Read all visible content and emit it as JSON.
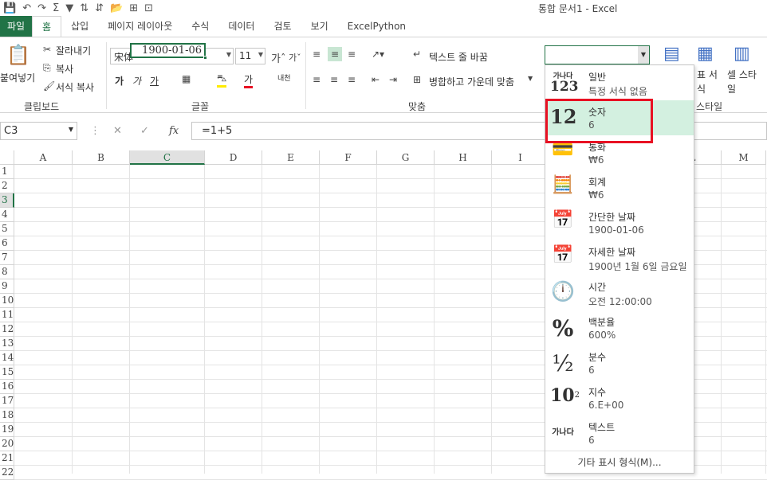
{
  "window": {
    "title": "통합 문서1 - Excel"
  },
  "qat": [
    "save-icon",
    "undo-icon",
    "redo-icon",
    "sum-icon",
    "filter-icon",
    "sort-asc-icon",
    "sort-desc-icon",
    "open-icon",
    "icon-a",
    "icon-b"
  ],
  "tabs": [
    "파일",
    "홈",
    "삽입",
    "페이지 레이아웃",
    "수식",
    "데이터",
    "검토",
    "보기",
    "ExcelPython"
  ],
  "ribbon": {
    "clipboard": {
      "paste": "붙여넣기",
      "cut": "잘라내기",
      "copy": "복사",
      "format_painter": "서식 복사",
      "label": "클립보드"
    },
    "font": {
      "name": "宋体",
      "size": "11",
      "label": "글꼴",
      "bold": "가",
      "italic": "가",
      "underline": "가",
      "font_color": "가",
      "phonetic": "내천"
    },
    "align": {
      "wrap": "텍스트 줄 바꿈",
      "merge": "병합하고 가운데 맞춤",
      "label": "맞춤"
    },
    "styles": {
      "table_fmt": "표 서식",
      "cell_style": "셀 스타일",
      "label": "스타일"
    }
  },
  "formula_bar": {
    "name_box": "C3",
    "formula": "=1+5",
    "fx": "fx"
  },
  "sheet": {
    "columns": [
      "A",
      "B",
      "C",
      "D",
      "E",
      "F",
      "G",
      "H",
      "I",
      "J",
      "K",
      "L",
      "M"
    ],
    "rows": [
      "1",
      "2",
      "3",
      "4",
      "5",
      "6",
      "7",
      "8",
      "9",
      "10",
      "11",
      "12",
      "13",
      "14",
      "15",
      "16",
      "17",
      "18",
      "19",
      "20",
      "21",
      "22"
    ],
    "active_cell": "C3",
    "active_value": "1900-01-06"
  },
  "number_format_menu": {
    "items": [
      {
        "icon": "가나다 123",
        "name": "일반",
        "sample": "특정 서식 없음"
      },
      {
        "icon": "12",
        "name": "숫자",
        "sample": "6"
      },
      {
        "icon": "currency-icon",
        "name": "통화",
        "sample": "₩6"
      },
      {
        "icon": "accounting-icon",
        "name": "회계",
        "sample": " ₩6"
      },
      {
        "icon": "calendar-icon",
        "name": "간단한 날짜",
        "sample": "1900-01-06"
      },
      {
        "icon": "calendar-icon",
        "name": "자세한 날짜",
        "sample": "1900년 1월 6일 금요일"
      },
      {
        "icon": "clock-icon",
        "name": "시간",
        "sample": "오전 12:00:00"
      },
      {
        "icon": "%",
        "name": "백분율",
        "sample": "600%"
      },
      {
        "icon": "½",
        "name": "분수",
        "sample": "6"
      },
      {
        "icon": "10²",
        "name": "지수",
        "sample": "6.E+00"
      },
      {
        "icon": "가나다",
        "name": "텍스트",
        "sample": "6"
      }
    ],
    "more": "기타 표시 형식(M)...",
    "highlighted_index": 1
  },
  "colors": {
    "accent": "#217346",
    "highlight": "#d3f0e0",
    "annotation": "#e81123"
  }
}
